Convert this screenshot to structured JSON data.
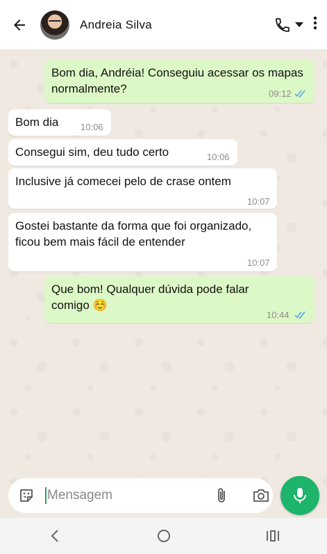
{
  "header": {
    "contact_name": "Andreia Silva"
  },
  "messages": [
    {
      "direction": "out",
      "text": "Bom dia, Andréia! Conseguiu acessar os mapas normalmente?",
      "time": "09:12",
      "status": "read"
    },
    {
      "direction": "in",
      "text": "Bom dia",
      "time": "10:06"
    },
    {
      "direction": "in",
      "text": "Consegui sim, deu tudo certo",
      "time": "10:06"
    },
    {
      "direction": "in",
      "text": "Inclusive já comecei pelo de crase ontem",
      "time": "10:07"
    },
    {
      "direction": "in",
      "text": "Gostei bastante da forma que foi organizado, ficou bem mais fácil de entender",
      "time": "10:07"
    },
    {
      "direction": "out",
      "text": "Que bom! Qualquer dúvida pode falar comigo ☺️",
      "time": "10:44",
      "status": "read"
    }
  ],
  "input": {
    "placeholder": "Mensagem",
    "value": ""
  },
  "icons": {
    "back": "arrow-left-icon",
    "call": "phone-icon",
    "menu": "more-vert-icon",
    "emoji": "sticker-icon",
    "attach": "paperclip-icon",
    "camera": "camera-icon",
    "mic": "mic-icon"
  },
  "colors": {
    "accent": "#1db46b",
    "outgoing_bubble": "#dcf8c6",
    "incoming_bubble": "#ffffff",
    "read_ticks": "#4fa3e8"
  }
}
